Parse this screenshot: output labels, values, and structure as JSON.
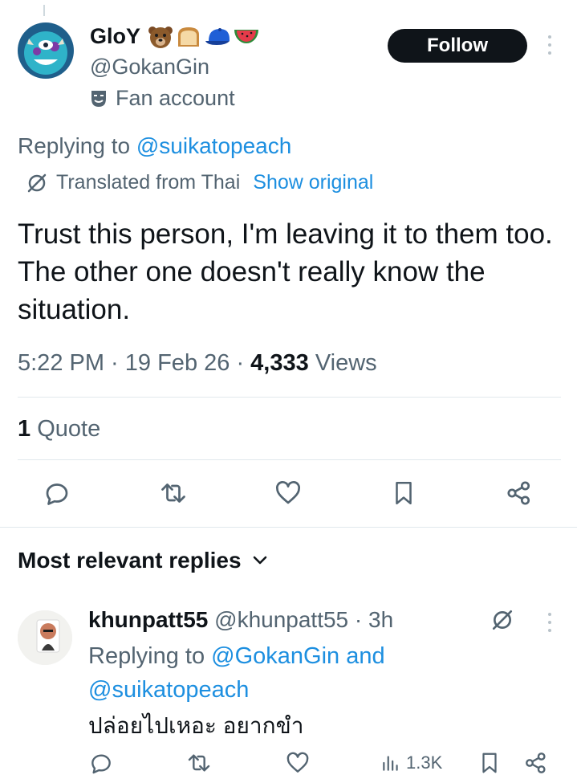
{
  "tweet": {
    "author": {
      "display_name": "GloY",
      "emoji_icons": [
        "bear-face-icon",
        "bread-icon",
        "blue-cap-icon",
        "watermelon-icon"
      ],
      "handle": "@GokanGin",
      "label": "Fan account"
    },
    "follow_label": "Follow",
    "replying_prefix": "Replying to",
    "replying_to": "@suikatopeach",
    "translated_text": "Translated from Thai",
    "show_original": "Show original",
    "text": "Trust this person, I'm leaving it to them too. The other one doesn't really know the situation.",
    "time": "5:22 PM",
    "date": "19 Feb 26",
    "views_count": "4,333",
    "views_label": "Views",
    "quote_count": "1",
    "quote_label": "Quote",
    "actions": [
      "reply-icon",
      "retweet-icon",
      "like-icon",
      "bookmark-icon",
      "share-icon"
    ]
  },
  "replies_section": {
    "heading": "Most relevant replies"
  },
  "reply": {
    "display_name": "khunpatt55",
    "handle": "@khunpatt55",
    "separator": "·",
    "time_ago": "3h",
    "replying_prefix": "Replying to",
    "replying_to_1": "@GokanGin",
    "and": "and",
    "replying_to_2": "@suikatopeach",
    "text": "ปล่อยไปเหอะ อยากขำ",
    "views": "1.3K"
  },
  "colors": {
    "accent": "#1d8fe0",
    "text": "#0f1419",
    "muted": "#536471",
    "follow_bg": "#0f1419"
  }
}
